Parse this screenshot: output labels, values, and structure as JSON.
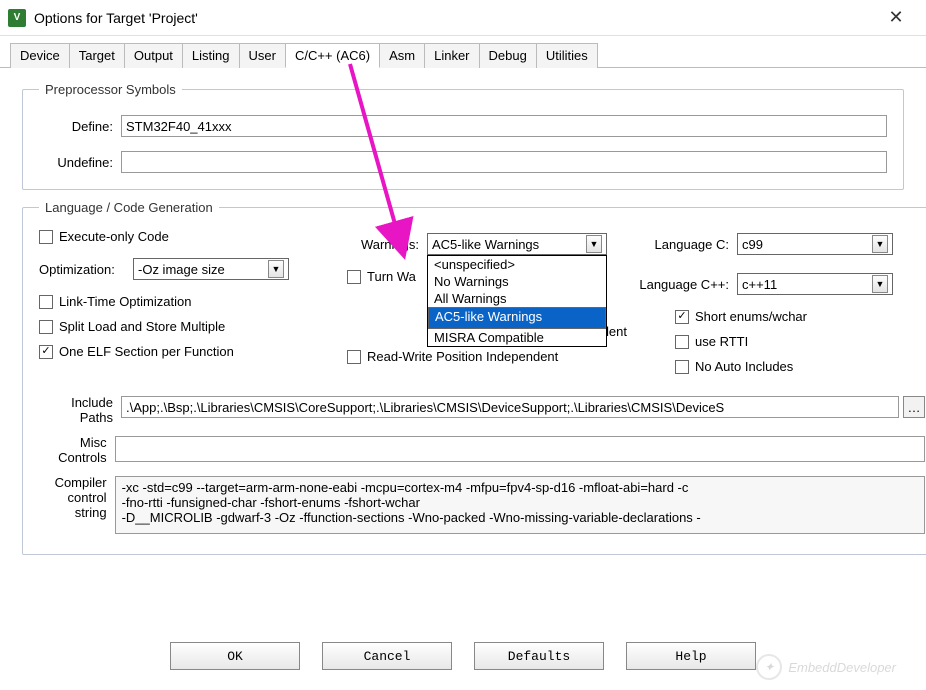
{
  "window": {
    "title": "Options for Target 'Project'"
  },
  "tabs": {
    "items": [
      "Device",
      "Target",
      "Output",
      "Listing",
      "User",
      "C/C++ (AC6)",
      "Asm",
      "Linker",
      "Debug",
      "Utilities"
    ],
    "active": 5
  },
  "preproc": {
    "legend": "Preprocessor Symbols",
    "define_label": "Define:",
    "define_value": "STM32F40_41xxx",
    "undefine_label": "Undefine:",
    "undefine_value": ""
  },
  "lang": {
    "legend": "Language / Code Generation",
    "exec_only": "Execute-only Code",
    "optimization_label": "Optimization:",
    "optimization_value": "-Oz image size",
    "lto": "Link-Time Optimization",
    "split": "Split Load and Store Multiple",
    "one_elf": "One ELF Section per Function",
    "warnings_label": "Warnings:",
    "warnings_value": "AC5-like Warnings",
    "warnings_options": [
      "<unspecified>",
      "No Warnings",
      "All Warnings",
      "AC5-like Warnings",
      "MISRA Compatible"
    ],
    "turn_warn": "Turn Wa",
    "roposind_tail": "pendent",
    "rwposind": "Read-Write Position Independent",
    "langc_label": "Language C:",
    "langc_value": "c99",
    "langcpp_label": "Language C++:",
    "langcpp_value": "c++11",
    "short_enums": "Short enums/wchar",
    "use_rtti": "use RTTI",
    "no_auto_inc": "No Auto Includes"
  },
  "paths": {
    "include_label": "Include\nPaths",
    "include_value": ".\\App;.\\Bsp;.\\Libraries\\CMSIS\\CoreSupport;.\\Libraries\\CMSIS\\DeviceSupport;.\\Libraries\\CMSIS\\DeviceS",
    "misc_label": "Misc\nControls",
    "misc_value": "",
    "compiler_label": "Compiler\ncontrol\nstring",
    "compiler_value": "-xc -std=c99 --target=arm-arm-none-eabi -mcpu=cortex-m4 -mfpu=fpv4-sp-d16 -mfloat-abi=hard -c\n-fno-rtti -funsigned-char -fshort-enums -fshort-wchar\n-D__MICROLIB -gdwarf-3 -Oz -ffunction-sections -Wno-packed -Wno-missing-variable-declarations -"
  },
  "buttons": {
    "ok": "OK",
    "cancel": "Cancel",
    "defaults": "Defaults",
    "help": "Help"
  },
  "watermark": "EmbeddDeveloper"
}
